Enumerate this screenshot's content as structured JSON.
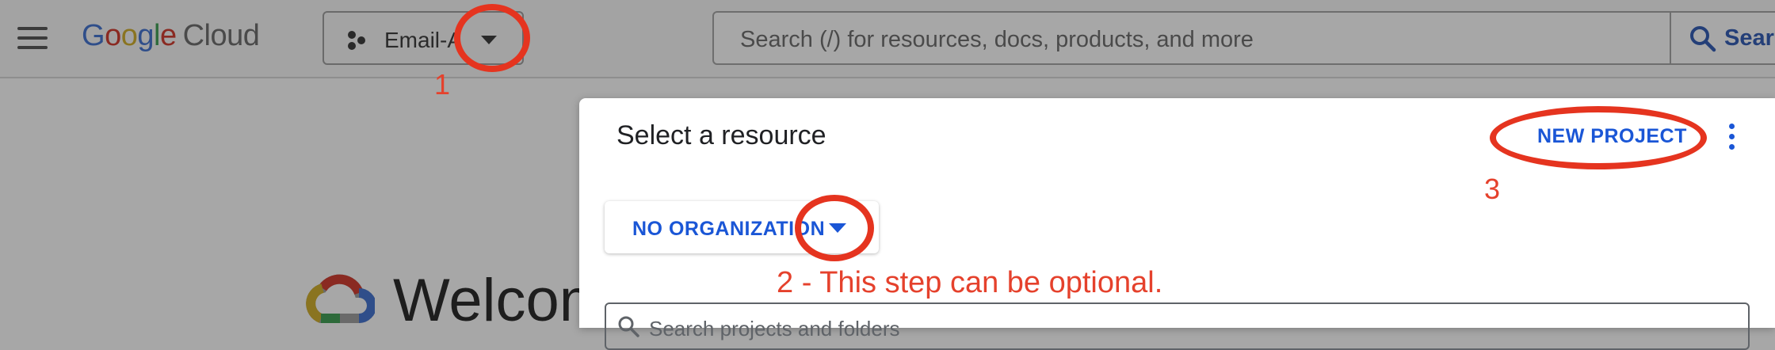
{
  "topbar": {
    "menu_icon": "hamburger-menu-icon",
    "logo": {
      "google": "Google",
      "cloud": "Cloud"
    },
    "project_picker": {
      "label": "Email-A",
      "icon": "project-dots-icon",
      "dropdown_icon": "caret-down-icon"
    },
    "search": {
      "placeholder": "Search (/) for resources, docs, products, and more",
      "button_label": "Search",
      "icon": "search-icon"
    }
  },
  "background": {
    "welcome_text": "Welcom",
    "logo_icon": "google-cloud-logo-icon"
  },
  "dialog": {
    "title": "Select a resource",
    "new_project_label": "NEW PROJECT",
    "more_icon": "more-vert-icon",
    "organization": {
      "label": "NO ORGANIZATION",
      "dropdown_icon": "caret-down-icon"
    },
    "search": {
      "placeholder": "Search projects and folders"
    }
  },
  "annotations": {
    "step_1": "1",
    "step_2": "2 - This step can be optional.",
    "step_3": "3",
    "color": "#e5341f"
  }
}
